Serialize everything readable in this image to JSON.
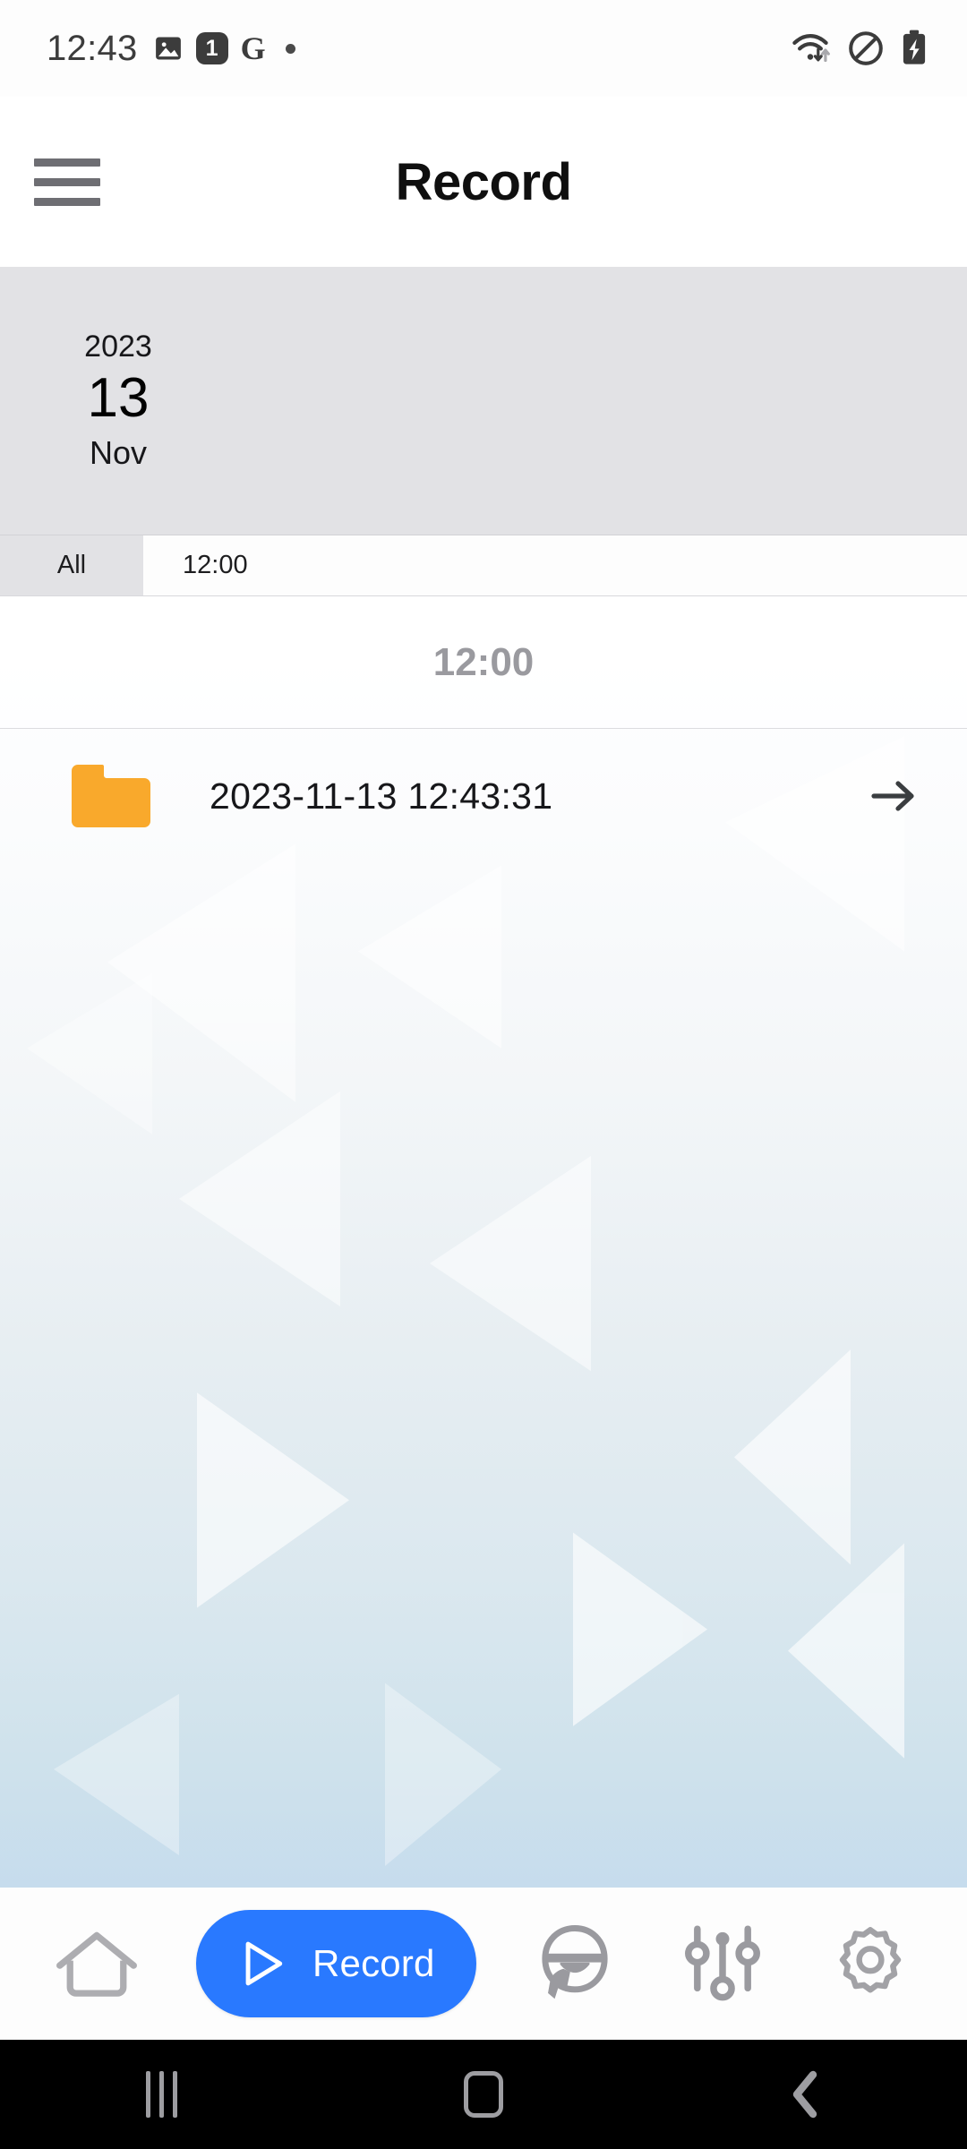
{
  "status_bar": {
    "time": "12:43",
    "left_icons": [
      "photo-icon",
      "notification-badge",
      "google-icon",
      "dot-indicator"
    ],
    "badge_count": "1",
    "google_letter": "G",
    "right_icons": [
      "wifi-icon",
      "do-not-disturb-icon",
      "battery-charging-icon"
    ]
  },
  "header": {
    "title": "Record",
    "menu_icon": "hamburger-menu-icon"
  },
  "date_card": {
    "year": "2023",
    "day": "13",
    "month": "Nov"
  },
  "tabs": [
    {
      "label": "All",
      "selected": true
    },
    {
      "label": "12:00",
      "selected": false
    }
  ],
  "section": {
    "header": "12:00"
  },
  "files": [
    {
      "name": "2023-11-13 12:43:31",
      "icon": "folder-icon",
      "icon_color": "#F9A92C",
      "arrow": "arrow-right-icon"
    }
  ],
  "bottom_nav": {
    "accent_color": "#2979FF",
    "items": [
      {
        "label": "",
        "icon": "home-icon",
        "active": false
      },
      {
        "label": "Record",
        "icon": "play-triangle-icon",
        "active": true
      },
      {
        "label": "",
        "icon": "steering-wheel-icon",
        "active": false
      },
      {
        "label": "",
        "icon": "sliders-icon",
        "active": false
      },
      {
        "label": "",
        "icon": "gear-icon",
        "active": false
      }
    ]
  },
  "android_nav": {
    "items": [
      "recents-icon",
      "home-square-icon",
      "back-chevron-icon"
    ]
  }
}
